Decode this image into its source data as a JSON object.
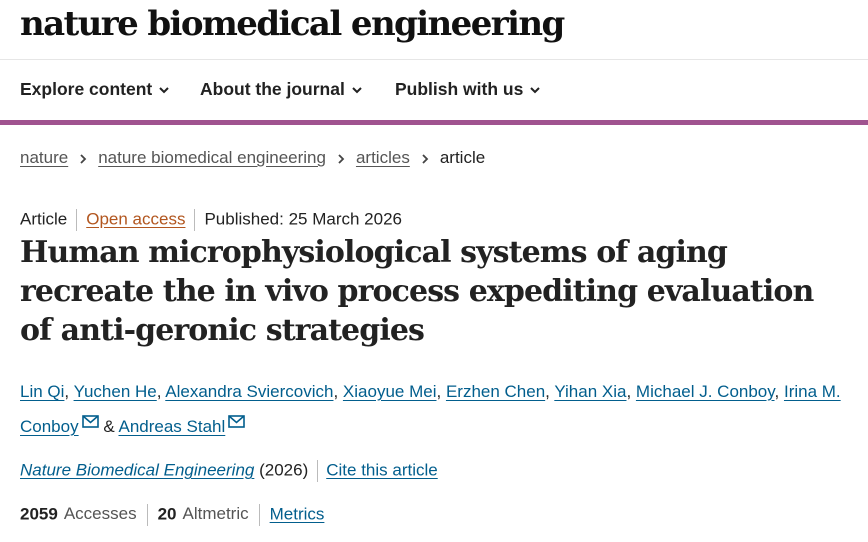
{
  "header": {
    "logo": "nature biomedical engineering"
  },
  "nav": {
    "items": [
      {
        "label": "Explore content"
      },
      {
        "label": "About the journal"
      },
      {
        "label": "Publish with us"
      }
    ]
  },
  "breadcrumb": {
    "items": [
      {
        "label": "nature"
      },
      {
        "label": "nature biomedical engineering"
      },
      {
        "label": "articles"
      }
    ],
    "current": "article"
  },
  "article": {
    "type": "Article",
    "access": "Open access",
    "published": "Published: 25 March 2026",
    "title": "Human microphysiological systems of aging recreate the in vivo process expediting evaluation of anti-geronic strategies",
    "authors": [
      "Lin Qi",
      "Yuchen He",
      "Alexandra Sviercovich",
      "Xiaoyue Mei",
      "Erzhen Chen",
      "Yihan Xia",
      "Michael J. Conboy",
      "Irina M. Conboy",
      "Andreas Stahl"
    ],
    "author_separator": ", ",
    "author_joiner": "&",
    "journal": "Nature Biomedical Engineering",
    "year": "(2026)",
    "cite_label": "Cite this article"
  },
  "metrics": {
    "accesses_value": "2059",
    "accesses_label": "Accesses",
    "altmetric_value": "20",
    "altmetric_label": "Altmetric",
    "metrics_link": "Metrics"
  },
  "colors": {
    "accent_bar": "#a0538f",
    "link": "#025e8d",
    "open_access": "#b2561f"
  },
  "icons": [
    "chevron-down-icon",
    "chevron-right-icon",
    "envelope-icon"
  ]
}
